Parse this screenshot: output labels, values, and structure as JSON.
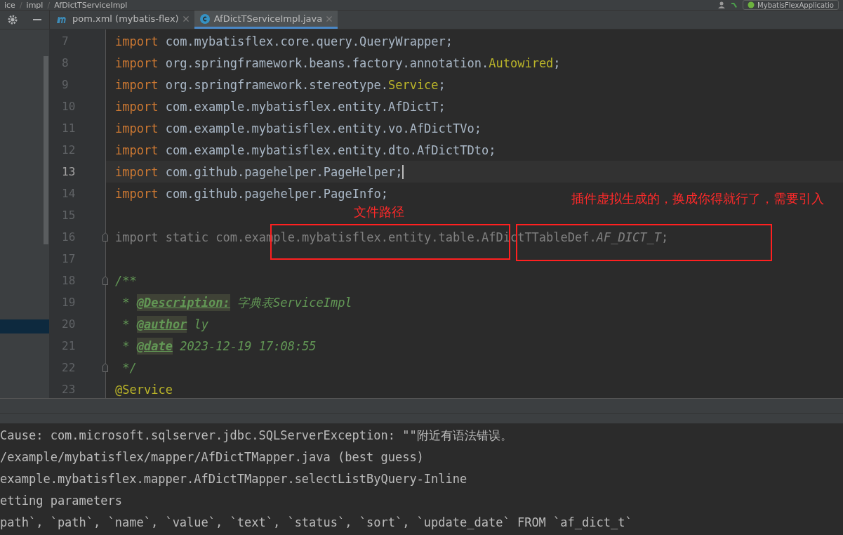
{
  "breadcrumb": [
    "ice",
    "impl",
    "AfDictTServiceImpl"
  ],
  "breadcrumb_separator": "/",
  "run_config": {
    "label": "MybatisFlexApplicatio"
  },
  "tabs": [
    {
      "label": "pom.xml (mybatis-flex)",
      "kind": "maven",
      "selected": false
    },
    {
      "label": "AfDictTServiceImpl.java",
      "kind": "class",
      "selected": true
    }
  ],
  "editor": {
    "lines": [
      {
        "number": "7",
        "current": false,
        "fold": false,
        "segments": [
          {
            "kind": "kw",
            "text": "import "
          },
          {
            "kind": "plain",
            "text": "com.mybatisflex.core.query.QueryWrapper;"
          }
        ]
      },
      {
        "number": "8",
        "current": false,
        "fold": false,
        "segments": [
          {
            "kind": "kw",
            "text": "import "
          },
          {
            "kind": "plain",
            "text": "org.springframework.beans.factory.annotation."
          },
          {
            "kind": "ann",
            "text": "Autowired"
          },
          {
            "kind": "plain",
            "text": ";"
          }
        ]
      },
      {
        "number": "9",
        "current": false,
        "fold": false,
        "segments": [
          {
            "kind": "kw",
            "text": "import "
          },
          {
            "kind": "plain",
            "text": "org.springframework.stereotype."
          },
          {
            "kind": "ann",
            "text": "Service"
          },
          {
            "kind": "plain",
            "text": ";"
          }
        ]
      },
      {
        "number": "10",
        "current": false,
        "fold": false,
        "segments": [
          {
            "kind": "kw",
            "text": "import "
          },
          {
            "kind": "plain",
            "text": "com.example.mybatisflex.entity.AfDictT;"
          }
        ]
      },
      {
        "number": "11",
        "current": false,
        "fold": false,
        "segments": [
          {
            "kind": "kw",
            "text": "import "
          },
          {
            "kind": "plain",
            "text": "com.example.mybatisflex.entity.vo.AfDictTVo;"
          }
        ]
      },
      {
        "number": "12",
        "current": false,
        "fold": false,
        "segments": [
          {
            "kind": "kw",
            "text": "import "
          },
          {
            "kind": "plain",
            "text": "com.example.mybatisflex.entity.dto.AfDictTDto;"
          }
        ]
      },
      {
        "number": "13",
        "current": true,
        "fold": false,
        "segments": [
          {
            "kind": "kw",
            "text": "import "
          },
          {
            "kind": "plain",
            "text": "com.github.pagehelper.PageHelper;"
          }
        ]
      },
      {
        "number": "14",
        "current": false,
        "fold": false,
        "segments": [
          {
            "kind": "kw",
            "text": "import "
          },
          {
            "kind": "plain",
            "text": "com.github.pagehelper.PageInfo;"
          }
        ]
      },
      {
        "number": "15",
        "current": false,
        "fold": false
      },
      {
        "number": "16",
        "current": false,
        "fold": true,
        "segments": [
          {
            "kind": "unused",
            "text": "import static com.example.mybatisflex.entity.table.AfDictTTableDef."
          },
          {
            "kind": "unused-italic",
            "text": "AF_DICT_T"
          },
          {
            "kind": "unused",
            "text": ";"
          }
        ]
      },
      {
        "number": "17",
        "current": false,
        "fold": false
      },
      {
        "number": "18",
        "current": false,
        "fold": true,
        "segments": [
          {
            "kind": "doc",
            "text": "/**"
          }
        ]
      },
      {
        "number": "19",
        "current": false,
        "fold": false,
        "segments": [
          {
            "kind": "doc",
            "text": " * "
          },
          {
            "kind": "doctag",
            "text": "@Description:"
          },
          {
            "kind": "doc",
            "text": " 字典表ServiceImpl"
          }
        ]
      },
      {
        "number": "20",
        "current": false,
        "fold": false,
        "segments": [
          {
            "kind": "doc",
            "text": " * "
          },
          {
            "kind": "doctag",
            "text": "@author"
          },
          {
            "kind": "doc",
            "text": " ly"
          }
        ]
      },
      {
        "number": "21",
        "current": false,
        "fold": false,
        "segments": [
          {
            "kind": "doc",
            "text": " * "
          },
          {
            "kind": "doctag",
            "text": "@date"
          },
          {
            "kind": "doc",
            "text": " 2023-12-19 17:08:55"
          }
        ]
      },
      {
        "number": "22",
        "current": false,
        "fold": true,
        "segments": [
          {
            "kind": "doc",
            "text": " */"
          }
        ]
      },
      {
        "number": "23",
        "current": false,
        "fold": false,
        "segments": [
          {
            "kind": "ann",
            "text": "@Service"
          }
        ]
      }
    ]
  },
  "annotations": [
    {
      "label": "文件路径"
    },
    {
      "label": "插件虚拟生成的，换成你得就行了，需要引入"
    }
  ],
  "console": {
    "lines": [
      "Cause: com.microsoft.sqlserver.jdbc.SQLServerException: \"\"附近有语法错误。",
      "/example/mybatisflex/mapper/AfDictTMapper.java (best guess)",
      "example.mybatisflex.mapper.AfDictTMapper.selectListByQuery-Inline",
      "etting parameters",
      "path`, `path`, `name`, `value`, `text`, `status`, `sort`, `update_date` FROM `af_dict_t`"
    ]
  }
}
